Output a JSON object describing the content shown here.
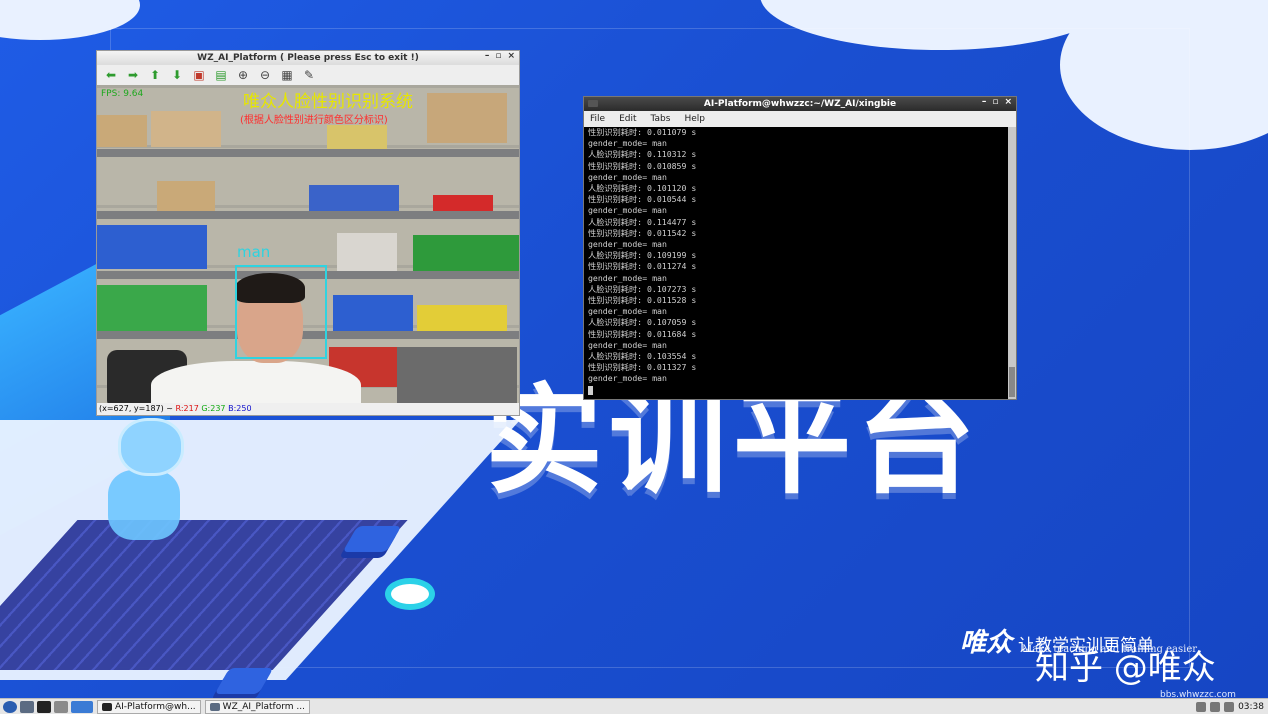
{
  "desktop": {
    "headline": "实训平台",
    "brand": "唯众",
    "slogan": "让教学实训更简单",
    "slogan_en": "Make teaching and training easier",
    "watermark": "知乎 @唯众",
    "watermark_small": "bbs.whwzzc.com"
  },
  "camera_window": {
    "title": "WZ_AI_Platform ( Please press Esc to exit !)",
    "overlay_title": "唯众人脸性别识别系统",
    "overlay_subtitle": "(根据人脸性别进行颜色区分标识)",
    "fps": "FPS: 9.64",
    "face_label": "man",
    "status_coords": "(x=627, y=187) ~ ",
    "status_r": "R:217",
    "status_g": "G:237",
    "status_b": "B:250",
    "toolbar_icons": [
      "arrow-left-icon",
      "arrow-right-icon",
      "arrow-up-icon",
      "arrow-down-icon",
      "save-image-icon",
      "photo-icon",
      "zoom-in-icon",
      "zoom-out-icon",
      "disk-icon",
      "brush-icon"
    ]
  },
  "terminal_window": {
    "title": "AI-Platform@whwzzc:~/WZ_AI/xingbie",
    "menu": [
      "File",
      "Edit",
      "Tabs",
      "Help"
    ],
    "lines": [
      "性别识别耗时: 0.011079 s",
      "gender_mode= man",
      "人脸识别耗时: 0.110312 s",
      "性别识别耗时: 0.010859 s",
      "gender_mode= man",
      "人脸识别耗时: 0.101120 s",
      "性别识别耗时: 0.010544 s",
      "gender_mode= man",
      "人脸识别耗时: 0.114477 s",
      "性别识别耗时: 0.011542 s",
      "gender_mode= man",
      "人脸识别耗时: 0.109199 s",
      "性别识别耗时: 0.011274 s",
      "gender_mode= man",
      "人脸识别耗时: 0.107273 s",
      "性别识别耗时: 0.011528 s",
      "gender_mode= man",
      "人脸识别耗时: 0.107059 s",
      "性别识别耗时: 0.011684 s",
      "gender_mode= man",
      "人脸识别耗时: 0.103554 s",
      "性别识别耗时: 0.011327 s",
      "gender_mode= man"
    ]
  },
  "taskbar": {
    "tasks": [
      "AI-Platform@wh...",
      "WZ_AI_Platform ..."
    ],
    "clock": "03:38"
  }
}
